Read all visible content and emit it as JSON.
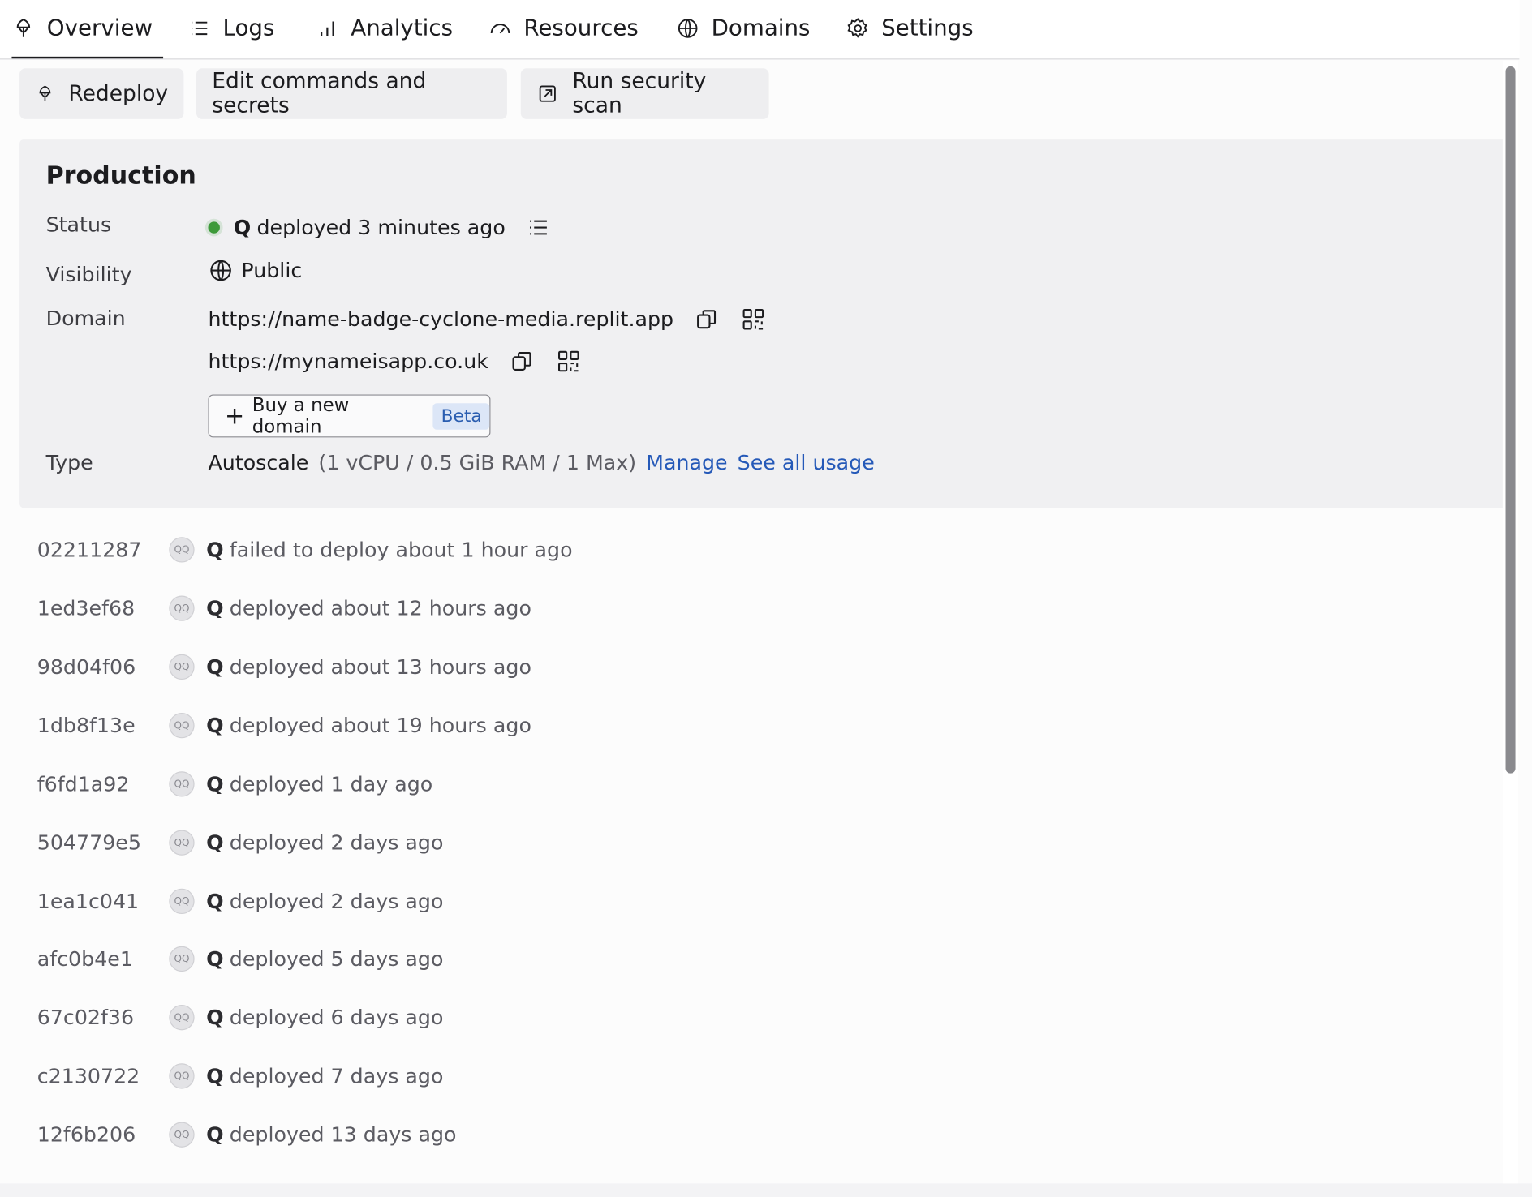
{
  "tabs": [
    {
      "label": "Overview",
      "icon": "rocket-icon"
    },
    {
      "label": "Logs",
      "icon": "list-icon"
    },
    {
      "label": "Analytics",
      "icon": "bar-chart-icon"
    },
    {
      "label": "Resources",
      "icon": "gauge-icon"
    },
    {
      "label": "Domains",
      "icon": "globe-icon"
    },
    {
      "label": "Settings",
      "icon": "gear-icon"
    }
  ],
  "actions": {
    "redeploy": "Redeploy",
    "edit": "Edit commands and secrets",
    "scan": "Run security scan"
  },
  "production": {
    "title": "Production",
    "status_label": "Status",
    "status_user": "Q",
    "status_text": "deployed 3 minutes ago",
    "visibility_label": "Visibility",
    "visibility_value": "Public",
    "domain_label": "Domain",
    "domains": [
      "https://name-badge-cyclone-media.replit.app",
      "https://mynameisapp.co.uk"
    ],
    "buy_domain": "Buy a new domain",
    "beta": "Beta",
    "type_label": "Type",
    "type_value": "Autoscale",
    "type_detail": "(1 vCPU / 0.5 GiB RAM / 1 Max)",
    "manage": "Manage",
    "usage": "See all usage"
  },
  "history": [
    {
      "hash": "02211287",
      "user": "Q",
      "text": "failed to deploy about 1 hour ago"
    },
    {
      "hash": "1ed3ef68",
      "user": "Q",
      "text": "deployed about 12 hours ago"
    },
    {
      "hash": "98d04f06",
      "user": "Q",
      "text": "deployed about 13 hours ago"
    },
    {
      "hash": "1db8f13e",
      "user": "Q",
      "text": "deployed about 19 hours ago"
    },
    {
      "hash": "f6fd1a92",
      "user": "Q",
      "text": "deployed 1 day ago"
    },
    {
      "hash": "504779e5",
      "user": "Q",
      "text": "deployed 2 days ago"
    },
    {
      "hash": "1ea1c041",
      "user": "Q",
      "text": "deployed 2 days ago"
    },
    {
      "hash": "afc0b4e1",
      "user": "Q",
      "text": "deployed 5 days ago"
    },
    {
      "hash": "67c02f36",
      "user": "Q",
      "text": "deployed 6 days ago"
    },
    {
      "hash": "c2130722",
      "user": "Q",
      "text": "deployed 7 days ago"
    },
    {
      "hash": "12f6b206",
      "user": "Q",
      "text": "deployed 13 days ago"
    }
  ],
  "colors": {
    "status_ok": "#3e9a3a",
    "link": "#2559b8",
    "beta_bg": "#dce6f7"
  }
}
